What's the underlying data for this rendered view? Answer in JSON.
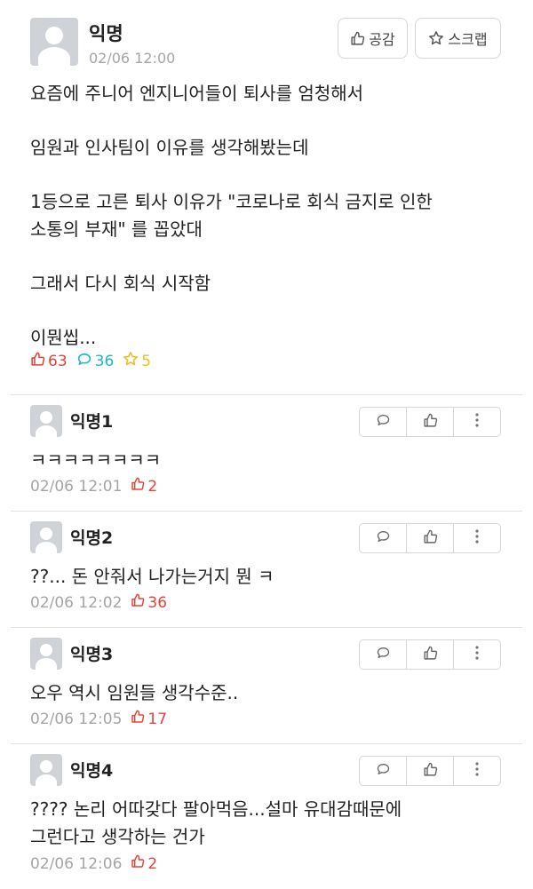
{
  "post": {
    "author": "익명",
    "time": "02/06 12:00",
    "like_button_label": "공감",
    "scrap_button_label": "스크랩",
    "body_lines": [
      "요즘에 주니어 엔지니어들이 퇴사를 엄청해서",
      "임원과 인사팀이 이유를 생각해봤는데",
      "1등으로 고른 퇴사 이유가 \"코로나로 회식 금지로 인한",
      "소통의 부재\" 를 꼽았대",
      "그래서 다시 회식 시작함",
      "이뭔씹..."
    ],
    "stats": {
      "likes": "63",
      "comments": "36",
      "scraps": "5"
    }
  },
  "comments": [
    {
      "author": "익명1",
      "text_lines": [
        "ㅋㅋㅋㅋㅋㅋㅋㅋ"
      ],
      "time": "02/06 12:01",
      "likes": "2"
    },
    {
      "author": "익명2",
      "text_lines": [
        "??... 돈 안줘서 나가는거지 뭔 ㅋ"
      ],
      "time": "02/06 12:02",
      "likes": "36"
    },
    {
      "author": "익명3",
      "text_lines": [
        "오우 역시 임원들 생각수준.."
      ],
      "time": "02/06 12:05",
      "likes": "17"
    },
    {
      "author": "익명4",
      "text_lines": [
        "???? 논리 어따갖다 팔아먹음...설마 유대감때문에",
        "그런다고 생각하는 건가"
      ],
      "time": "02/06 12:06",
      "likes": "2"
    }
  ],
  "icons": {
    "like": "thumbs-up-icon",
    "comment": "speech-bubble-icon",
    "scrap": "star-icon",
    "more": "more-vertical-icon"
  },
  "colors": {
    "like": "#e0453a",
    "comment": "#1fb8c4",
    "scrap": "#e6c324",
    "meta": "#a5a5a5",
    "border": "#d7d7d7"
  }
}
